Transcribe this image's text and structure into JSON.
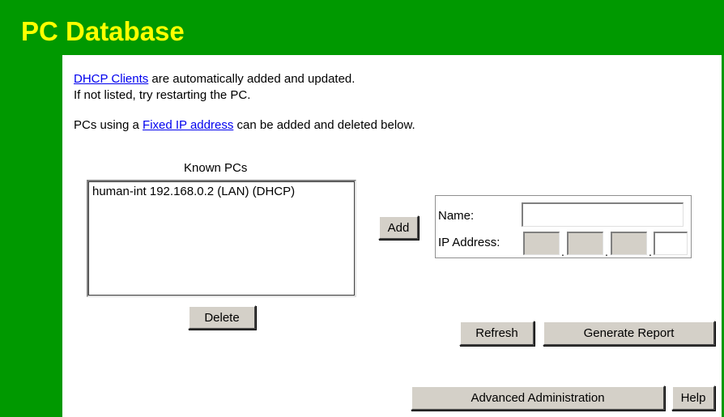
{
  "page": {
    "title": "PC Database"
  },
  "intro": {
    "dhcp_link": "DHCP Clients",
    "dhcp_text": " are automatically added and updated.",
    "restart_text": "If not listed, try restarting the PC.",
    "fixed_prefix": "PCs using a ",
    "fixed_link": "Fixed IP address",
    "fixed_suffix": " can be added and deleted below."
  },
  "known_pcs": {
    "label": "Known PCs",
    "items": [
      "human-int 192.168.0.2 (LAN) (DHCP)"
    ],
    "delete_label": "Delete"
  },
  "add_form": {
    "add_label": "Add",
    "name_label": "Name:",
    "name_value": "",
    "ip_label": "IP Address:",
    "ip_separator": ".",
    "ip_octets": [
      "",
      "",
      "",
      ""
    ]
  },
  "actions": {
    "refresh_label": "Refresh",
    "report_label": "Generate Report",
    "advanced_label": "Advanced Administration",
    "help_label": "Help"
  },
  "colors": {
    "frame_green": "#009900",
    "title_yellow": "#ffff00",
    "link_blue": "#0000ee",
    "button_gray": "#d4d0c8"
  }
}
